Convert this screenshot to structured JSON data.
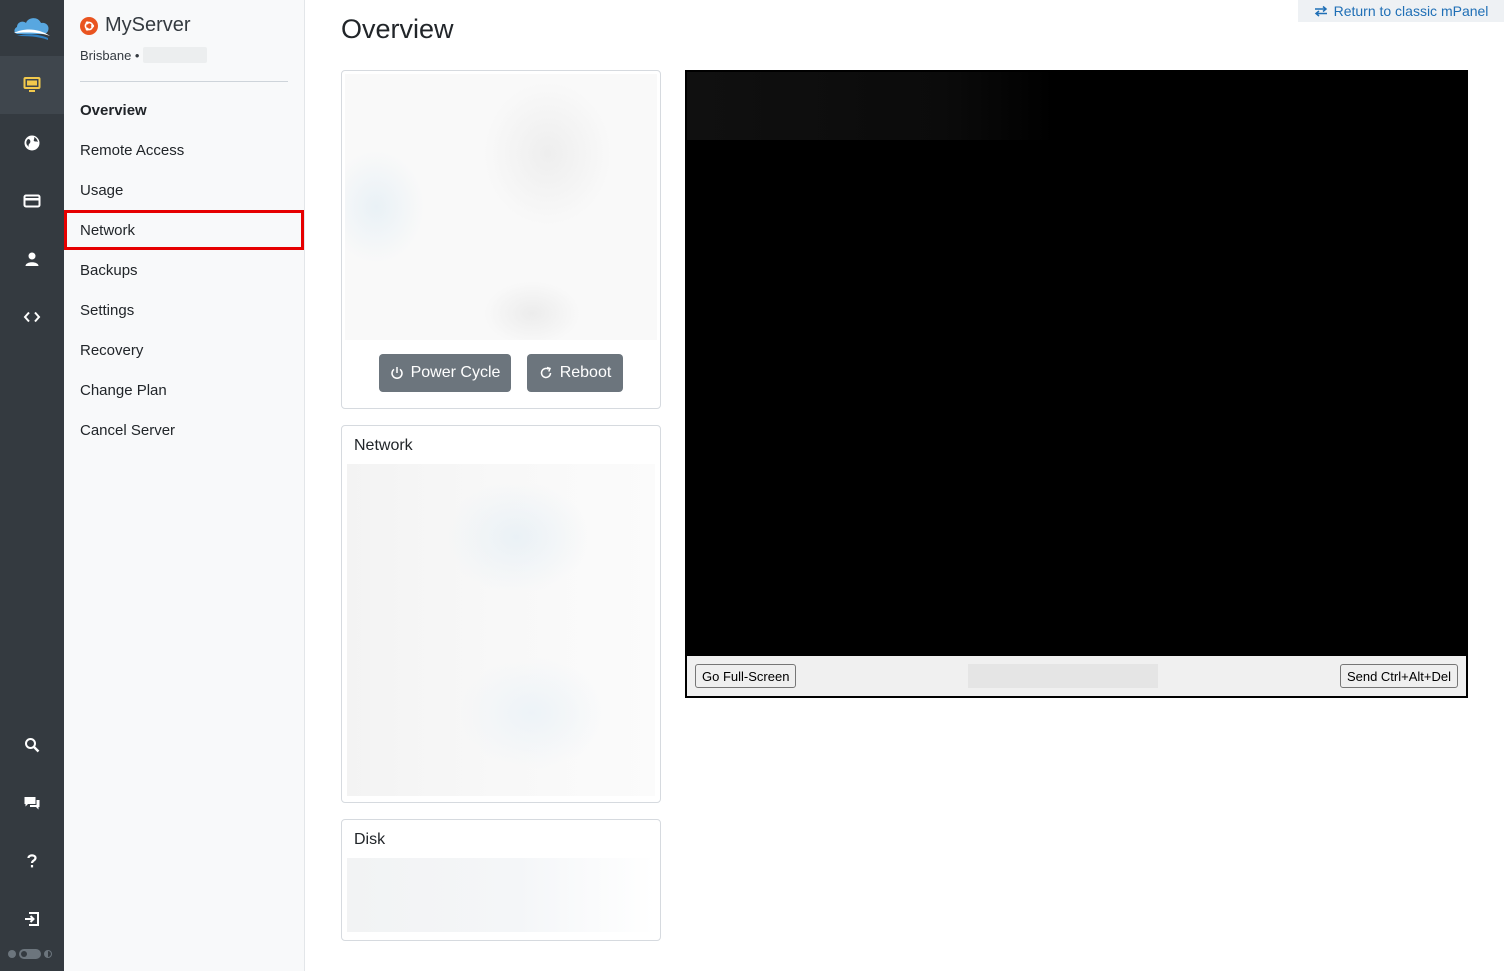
{
  "server": {
    "name": "MyServer",
    "location": "Brisbane •"
  },
  "nav": {
    "items": [
      {
        "label": "Overview"
      },
      {
        "label": "Remote Access"
      },
      {
        "label": "Usage"
      },
      {
        "label": "Network"
      },
      {
        "label": "Backups"
      },
      {
        "label": "Settings"
      },
      {
        "label": "Recovery"
      },
      {
        "label": "Change Plan"
      },
      {
        "label": "Cancel Server"
      }
    ],
    "active": "Overview",
    "highlighted": "Network"
  },
  "header": {
    "title": "Overview",
    "classic_link": "Return to classic mPanel"
  },
  "power_card": {
    "power_cycle_label": "Power Cycle",
    "reboot_label": "Reboot"
  },
  "network_card": {
    "title": "Network"
  },
  "disk_card": {
    "title": "Disk"
  },
  "console": {
    "fullscreen_label": "Go Full-Screen",
    "ctrl_alt_del_label": "Send Ctrl+Alt+Del"
  },
  "rail": {
    "icons": [
      "cloud-logo-icon",
      "monitor-icon",
      "globe-icon",
      "card-icon",
      "user-icon",
      "code-icon",
      "search-icon",
      "chat-icon",
      "help-icon",
      "logout-icon",
      "theme-toggle-icon"
    ]
  },
  "colors": {
    "rail_bg": "#343a40",
    "rail_active_icon": "#f2c94c",
    "sidebar_bg": "#f8f9fa",
    "button_bg": "#6c757d",
    "highlight": "#e60000",
    "link": "#1f6fb6",
    "ubuntu": "#e95420"
  }
}
